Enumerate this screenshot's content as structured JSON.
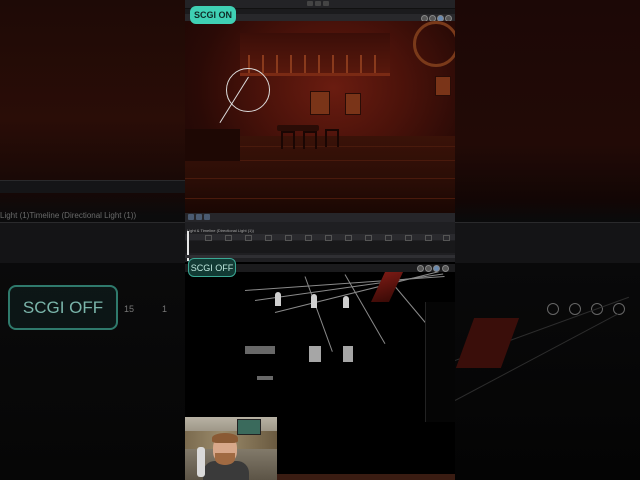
{
  "overlays": {
    "scgi_on_label": "SCGI ON",
    "scgi_off_label": "SCGI OFF",
    "background_scgi_off_label": "SCGI OFF"
  },
  "timeline": {
    "header_text": "Light & Timeline (Directional Light (1))",
    "background_header_text": "Light (1)Timeline (Directional Light (1))",
    "background_field_values": [
      "15",
      "1"
    ]
  },
  "colors": {
    "scgi_on_fill": "#3fd0b4",
    "scgi_off_border": "#3aa894",
    "scene_red": "#6a1c10"
  },
  "icons": [
    "gizmo-light-icon",
    "playhead-icon",
    "toolbar-icon"
  ]
}
